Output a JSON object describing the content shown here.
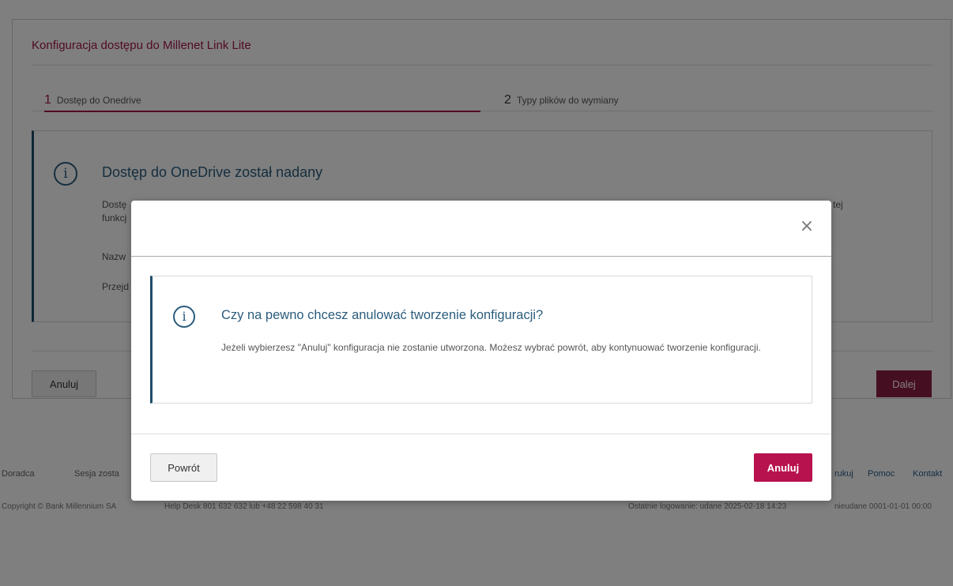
{
  "page": {
    "title": "Konfiguracja dostępu do Millenet Link Lite",
    "steps": [
      {
        "num": "1",
        "label": "Dostęp do Onedrive"
      },
      {
        "num": "2",
        "label": "Typy plików do wymiany"
      }
    ],
    "info": {
      "icon": "info-icon",
      "title": "Dostęp do OneDrive został nadany",
      "line1_visible": "Dostę",
      "line1_tail": "tej",
      "line2_visible": "funkcj",
      "line3_visible": "Nazw",
      "line4_visible": "Przejd"
    },
    "cancel_label": "Anuluj",
    "next_label": "Dalej"
  },
  "footer": {
    "doradca": "Doradca",
    "sesja": "Sesja zosta",
    "drukuj": "rukuj",
    "pomoc": "Pomoc",
    "kontakt": "Kontakt",
    "copyright": "Copyright © Bank Millennium SA",
    "helpdesk": "Help Desk 801 632 632 lub +48 22 598 40 31",
    "last_login": "Ostatnie logowanie: udane 2025-02-18 14:23",
    "failed_login": "nieudane 0001-01-01 00:00"
  },
  "modal": {
    "close_icon": "close-icon",
    "close_glyph": "×",
    "info_icon": "info-icon",
    "title": "Czy na pewno chcesz anulować tworzenie konfiguracji?",
    "text": "Jeżeli wybierzesz \"Anuluj\" konfiguracja nie zostanie utworzona. Możesz wybrać powrót, aby kontynuować tworzenie konfiguracji.",
    "back_label": "Powrót",
    "cancel_label": "Anuluj"
  },
  "colors": {
    "brand": "#a3174c",
    "primary_button": "#b8124e",
    "info_accent": "#2b5c7d"
  }
}
